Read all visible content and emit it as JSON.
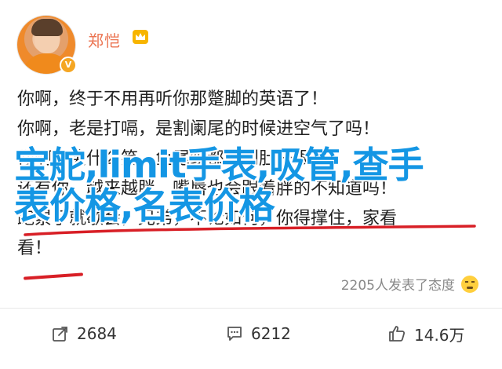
{
  "post": {
    "author": "郑恺",
    "verified_icon": "verified-badge-icon",
    "vip_icon": "crown-icon",
    "lines": [
      "你啊，终于不用再听你那蹩脚的英语了！",
      "你啊，老是打嗝，是割阑尾的时候进空气了吗！",
      "你啊，笑什么笑，鱼尾纹都掉到肚脐眼了！",
      "还有你，越来越胖，嘴唇也会跟着胖的不知道吗！",
      "跑累了就歇会，兄弟，不论如何，你得撑住，家看",
      "看！"
    ],
    "overlay_text": "宝舵,limit手表,吸管,查手表价格,名表价格",
    "meta": {
      "reposts_text": "2205人发表了态度",
      "emoji_icon": "sad-face-icon"
    }
  },
  "actions": {
    "share": {
      "icon": "share-icon",
      "count": "2684"
    },
    "comment": {
      "icon": "comment-icon",
      "count": "6212"
    },
    "like": {
      "icon": "thumbs-up-icon",
      "count": "14.6万"
    }
  },
  "colors": {
    "username": "#eb7350",
    "overlay": "#1496e4",
    "annotation": "#d81f26"
  }
}
